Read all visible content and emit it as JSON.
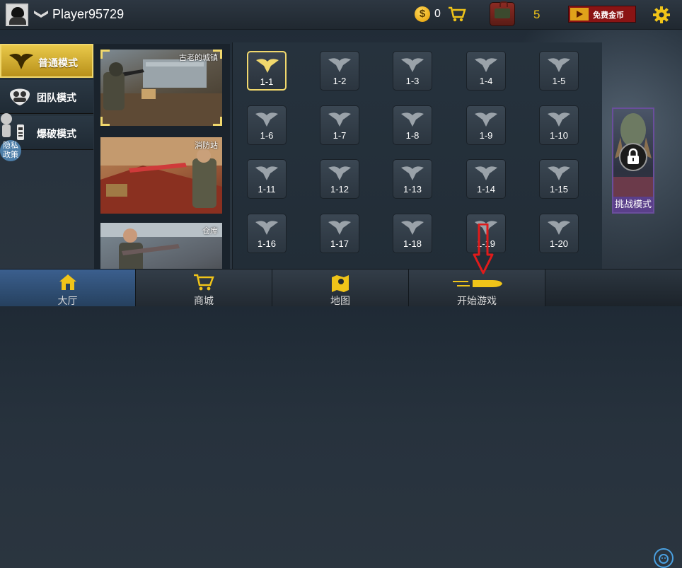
{
  "player": {
    "name": "Player95729"
  },
  "currency": {
    "coin_symbol": "$",
    "coins": "0",
    "backpack_count": "5",
    "free_gold_label": "免费金币"
  },
  "modes": [
    {
      "label": "普通模式",
      "active": true
    },
    {
      "label": "团队模式",
      "active": false
    },
    {
      "label": "爆破模式",
      "active": false
    }
  ],
  "privacy": {
    "label": "隐私政策"
  },
  "maps": [
    {
      "name": "古老的城镇",
      "selected": true
    },
    {
      "name": "消防站",
      "selected": false
    },
    {
      "name": "仓库",
      "selected": false
    }
  ],
  "levels": [
    "1-1",
    "1-2",
    "1-3",
    "1-4",
    "1-5",
    "1-6",
    "1-7",
    "1-8",
    "1-9",
    "1-10",
    "1-11",
    "1-12",
    "1-13",
    "1-14",
    "1-15",
    "1-16",
    "1-17",
    "1-18",
    "1-19",
    "1-20"
  ],
  "active_level": "1-1",
  "challenge": {
    "label": "挑战模式"
  },
  "bottom_nav": [
    {
      "label": "大厅",
      "icon": "home-icon",
      "active": true
    },
    {
      "label": "商城",
      "icon": "cart-icon",
      "active": false
    },
    {
      "label": "地图",
      "icon": "map-icon",
      "active": false
    },
    {
      "label": "开始游戏",
      "icon": "bullet-icon",
      "active": false
    }
  ],
  "colors": {
    "accent_gold": "#f1d86d",
    "tab_blue": "#3b5f8e",
    "arrow_red": "#e01b1b"
  }
}
